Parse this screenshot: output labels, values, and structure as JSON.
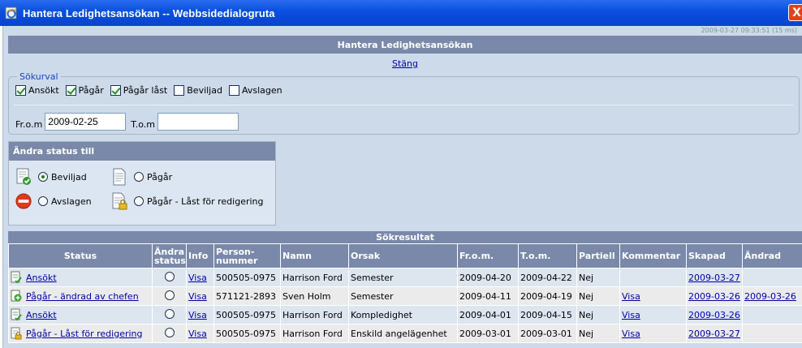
{
  "window": {
    "title": "Hantera Ledighetsansökan -- Webbsidedialogruta",
    "close_symbol": "X"
  },
  "timestamp": "2009-03-27 09:33:51 (15 ms)",
  "header": {
    "title": "Hantera Ledighetsansökan",
    "close_link": "Stäng"
  },
  "search": {
    "legend": "Sökurval",
    "checkboxes": [
      {
        "label": "Ansökt",
        "checked": true
      },
      {
        "label": "Pågår",
        "checked": true
      },
      {
        "label": "Pågår låst",
        "checked": true
      },
      {
        "label": "Beviljad",
        "checked": false
      },
      {
        "label": "Avslagen",
        "checked": false
      }
    ],
    "from_label": "Fr.o.m",
    "from_value": "2009-02-25",
    "to_label": "T.o.m",
    "to_value": ""
  },
  "status_change": {
    "title": "Ändra status till",
    "options": {
      "approved": {
        "label": "Beviljad",
        "selected": true,
        "icon": "approved-document-icon"
      },
      "rejected": {
        "label": "Avslagen",
        "selected": false,
        "icon": "no-entry-icon"
      },
      "in_progress": {
        "label": "Pågår",
        "selected": false,
        "icon": "document-icon"
      },
      "locked": {
        "label": "Pågår - Låst för redigering",
        "selected": false,
        "icon": "locked-document-icon"
      }
    }
  },
  "results": {
    "title": "Sökresultat",
    "columns": {
      "status": "Status",
      "andra_status_1": "Ändra",
      "andra_status_2": "status",
      "info": "Info",
      "person_1": "Person-",
      "person_2": "nummer",
      "namn": "Namn",
      "orsak": "Orsak",
      "from": "Fr.o.m.",
      "tom": "T.o.m.",
      "partiell": "Partiell",
      "kommentar": "Kommentar",
      "skapad": "Skapad",
      "andrad": "Ändrad"
    },
    "rows": [
      {
        "status": "Ansökt",
        "icon": "applied-icon",
        "info": "Visa",
        "person": "500505-0975",
        "namn": "Harrison Ford",
        "orsak": "Semester",
        "from": "2009-04-20",
        "tom": "2009-04-22",
        "partiell": "Nej",
        "kommentar": "",
        "skapad": "2009-03-27",
        "andrad": ""
      },
      {
        "status": "Pågår - ändrad av chefen",
        "icon": "changed-by-manager-icon",
        "info": "Visa",
        "person": "571121-2893",
        "namn": "Sven Holm",
        "orsak": "Semester",
        "from": "2009-04-11",
        "tom": "2009-04-19",
        "partiell": "Nej",
        "kommentar": "Visa",
        "skapad": "2009-03-26",
        "andrad": "2009-03-26"
      },
      {
        "status": "Ansökt",
        "icon": "applied-icon",
        "info": "Visa",
        "person": "500505-0975",
        "namn": "Harrison Ford",
        "orsak": "Kompledighet",
        "from": "2009-04-01",
        "tom": "2009-04-15",
        "partiell": "Nej",
        "kommentar": "Visa",
        "skapad": "2009-03-26",
        "andrad": ""
      },
      {
        "status": "Pågår - Låst för redigering",
        "icon": "locked-document-icon",
        "info": "Visa",
        "person": "500505-0975",
        "namn": "Harrison Ford",
        "orsak": "Enskild angelägenhet",
        "from": "2009-03-01",
        "tom": "2009-03-01",
        "partiell": "Nej",
        "kommentar": "Visa",
        "skapad": "2009-03-27",
        "andrad": ""
      }
    ]
  },
  "colors": {
    "header_bar": "#7a89a9",
    "client_bg": "#ccdaea",
    "title_bar": "#0a52e0",
    "link": "#0000aa"
  }
}
